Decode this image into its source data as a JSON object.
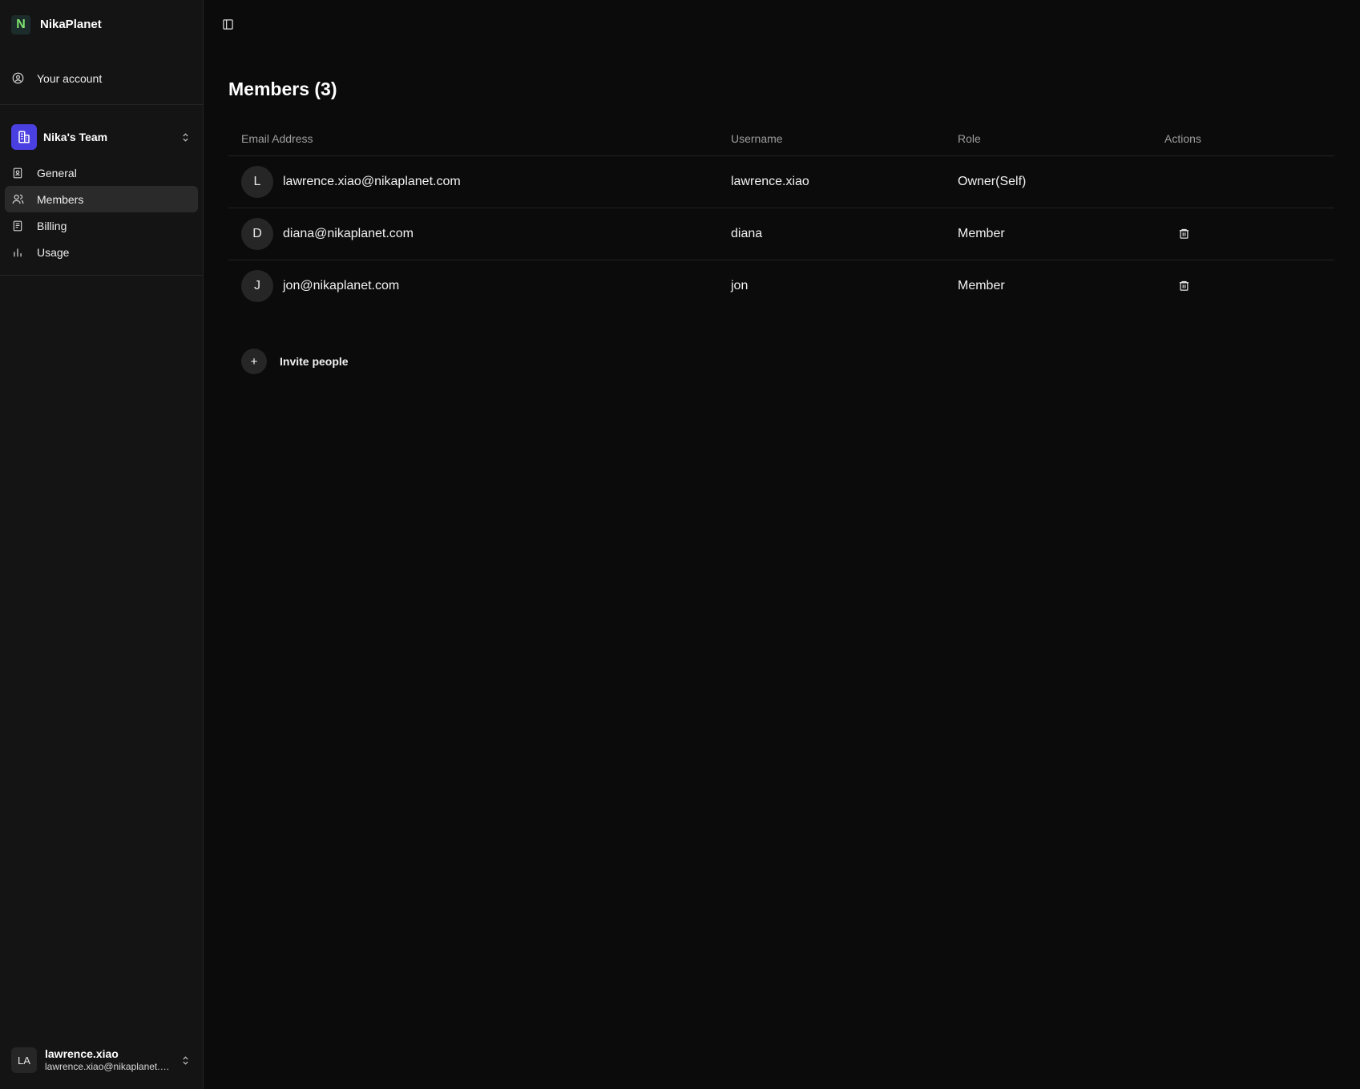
{
  "brand": {
    "logo_letter": "N",
    "name": "NikaPlanet",
    "logo_color": "#7ee36f"
  },
  "account": {
    "label": "Your account"
  },
  "team": {
    "name": "Nika's Team",
    "avatar_color": "#4a3fe0",
    "nav": [
      {
        "label": "General",
        "icon": "id-card-icon",
        "active": false
      },
      {
        "label": "Members",
        "icon": "users-icon",
        "active": true
      },
      {
        "label": "Billing",
        "icon": "receipt-icon",
        "active": false
      },
      {
        "label": "Usage",
        "icon": "bar-chart-icon",
        "active": false
      }
    ]
  },
  "user": {
    "initials": "LA",
    "name": "lawrence.xiao",
    "email": "lawrence.xiao@nikaplanet.com"
  },
  "page": {
    "title": "Members (3)"
  },
  "table": {
    "columns": {
      "email": "Email Address",
      "username": "Username",
      "role": "Role",
      "actions": "Actions"
    },
    "rows": [
      {
        "initial": "L",
        "email": "lawrence.xiao@nikaplanet.com",
        "username": "lawrence.xiao",
        "role": "Owner(Self)",
        "deletable": false
      },
      {
        "initial": "D",
        "email": "diana@nikaplanet.com",
        "username": "diana",
        "role": "Member",
        "deletable": true
      },
      {
        "initial": "J",
        "email": "jon@nikaplanet.com",
        "username": "jon",
        "role": "Member",
        "deletable": true
      }
    ]
  },
  "invite": {
    "icon": "+",
    "label": "Invite people"
  }
}
